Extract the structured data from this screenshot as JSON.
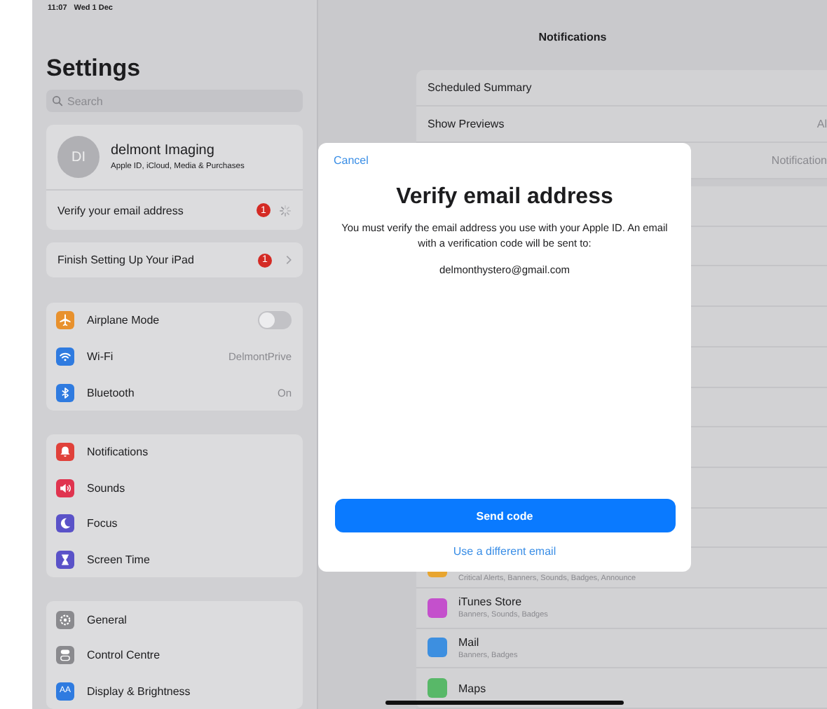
{
  "status_bar": {
    "time": "11:07",
    "date": "Wed 1 Dec"
  },
  "sidebar": {
    "title": "Settings",
    "search": {
      "placeholder": "Search"
    },
    "profile": {
      "initials": "DI",
      "name": "delmont Imaging",
      "subtitle": "Apple ID, iCloud, Media & Purchases",
      "alert": {
        "label": "Verify your email address",
        "badge": "1"
      }
    },
    "setup": {
      "label": "Finish Setting Up Your iPad",
      "badge": "1"
    },
    "groups": [
      [
        {
          "label": "Airplane Mode",
          "kind": "toggle",
          "on": false,
          "color": "#e8912d"
        },
        {
          "label": "Wi-Fi",
          "kind": "value",
          "value": "DelmontPrive",
          "color": "#2f7be0"
        },
        {
          "label": "Bluetooth",
          "kind": "value",
          "value": "On",
          "color": "#2f7be0"
        }
      ],
      [
        {
          "label": "Notifications",
          "kind": "plain",
          "color": "#e0413a"
        },
        {
          "label": "Sounds",
          "kind": "plain",
          "color": "#e0344f"
        },
        {
          "label": "Focus",
          "kind": "plain",
          "color": "#5a52c8"
        },
        {
          "label": "Screen Time",
          "kind": "plain",
          "color": "#5a52c8"
        }
      ],
      [
        {
          "label": "General",
          "kind": "plain",
          "color": "#8a8a8e"
        },
        {
          "label": "Control Centre",
          "kind": "plain",
          "color": "#8a8a8e"
        },
        {
          "label": "Display & Brightness",
          "kind": "plain",
          "color": "#2f7be0",
          "icon_label": "AA"
        }
      ]
    ]
  },
  "detail": {
    "title": "Notifications",
    "rows": [
      {
        "label": "Scheduled Summary"
      },
      {
        "label": "Show Previews",
        "value": "Al"
      },
      {
        "value": "Notification"
      }
    ],
    "apps": [
      {
        "subtitle": "Critical Alerts, Banners, Sounds, Badges, Announce",
        "color": "#e8a530"
      },
      {
        "name": "iTunes Store",
        "subtitle": "Banners, Sounds, Badges",
        "color": "#c450cc"
      },
      {
        "name": "Mail",
        "subtitle": "Banners, Badges",
        "color": "#3d8fe0"
      },
      {
        "name": "Maps",
        "color": "#58b868"
      }
    ]
  },
  "modal": {
    "cancel": "Cancel",
    "title": "Verify email address",
    "message": "You must verify the email address you use with your Apple ID. An email with a verification code will be sent to:",
    "email": "delmonthystero@gmail.com",
    "primary": "Send code",
    "secondary": "Use a different email"
  }
}
